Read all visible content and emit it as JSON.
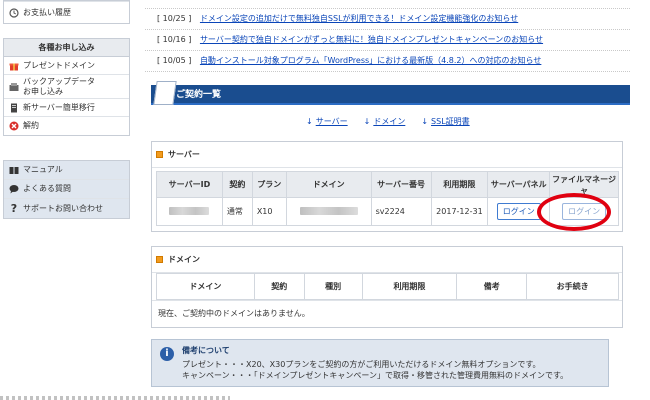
{
  "sidebar": {
    "top_box": {
      "item": "お支払い履歴"
    },
    "apply_box": {
      "title": "各種お申し込み",
      "items": [
        {
          "label": "プレゼントドメイン",
          "icon": "gift-icon"
        },
        {
          "label": "バックアップデータ",
          "label2": "お申し込み",
          "icon": "backup-icon"
        },
        {
          "label": "新サーバー簡単移行",
          "icon": "server-icon"
        },
        {
          "label": "解約",
          "icon": "cancel-icon"
        }
      ]
    },
    "help_box": {
      "items": [
        {
          "label": "マニュアル",
          "icon": "book-icon"
        },
        {
          "label": "よくある質問",
          "icon": "chat-icon"
        },
        {
          "label": "サポートお問い合わせ",
          "icon": "question-icon"
        }
      ]
    }
  },
  "news": [
    {
      "date": "[ 10/25 ]",
      "text": "ドメイン設定の追加だけで無料独自SSLが利用できる！ドメイン設定機能強化のお知らせ"
    },
    {
      "date": "[ 10/16 ]",
      "text": "サーバー契約で独自ドメインがずっと無料に！独自ドメインプレゼントキャンペーンのお知らせ"
    },
    {
      "date": "[ 10/05 ]",
      "text": "自動インストール対象プログラム「WordPress」における最新版（4.8.2）への対応のお知らせ"
    }
  ],
  "contracts": {
    "title": "ご契約一覧",
    "anchors": [
      "サーバー",
      "ドメイン",
      "SSL証明書"
    ]
  },
  "server_panel": {
    "title": "サーバー",
    "headers": [
      "サーバーID",
      "契約",
      "プラン",
      "ドメイン",
      "サーバー番号",
      "利用期限",
      "サーバーパネル",
      "ファイルマネージャ"
    ],
    "row": {
      "contract": "通常",
      "plan": "X10",
      "server_no": "sv2224",
      "expiry": "2017-12-31",
      "panel_button": "ログイン",
      "fm_button": "ログイン"
    }
  },
  "domain_panel": {
    "title": "ドメイン",
    "headers": [
      "ドメイン",
      "契約",
      "種別",
      "利用期限",
      "備考",
      "お手続き"
    ],
    "empty_message": "現在、ご契約中のドメインはありません。"
  },
  "note": {
    "title": "備考について",
    "lines": [
      "プレゼント・・・X20、X30プランをご契約の方がご利用いただけるドメイン無料オプションです。",
      "キャンペーン・・・「ドメインプレゼントキャンペーン」で取得・移管された管理費用無料のドメインです。"
    ]
  },
  "colors": {
    "header_bar": "#1a4d8f",
    "link": "#0a45b8",
    "highlight_circle": "#e00010",
    "accent_square": "#f29b1d"
  }
}
